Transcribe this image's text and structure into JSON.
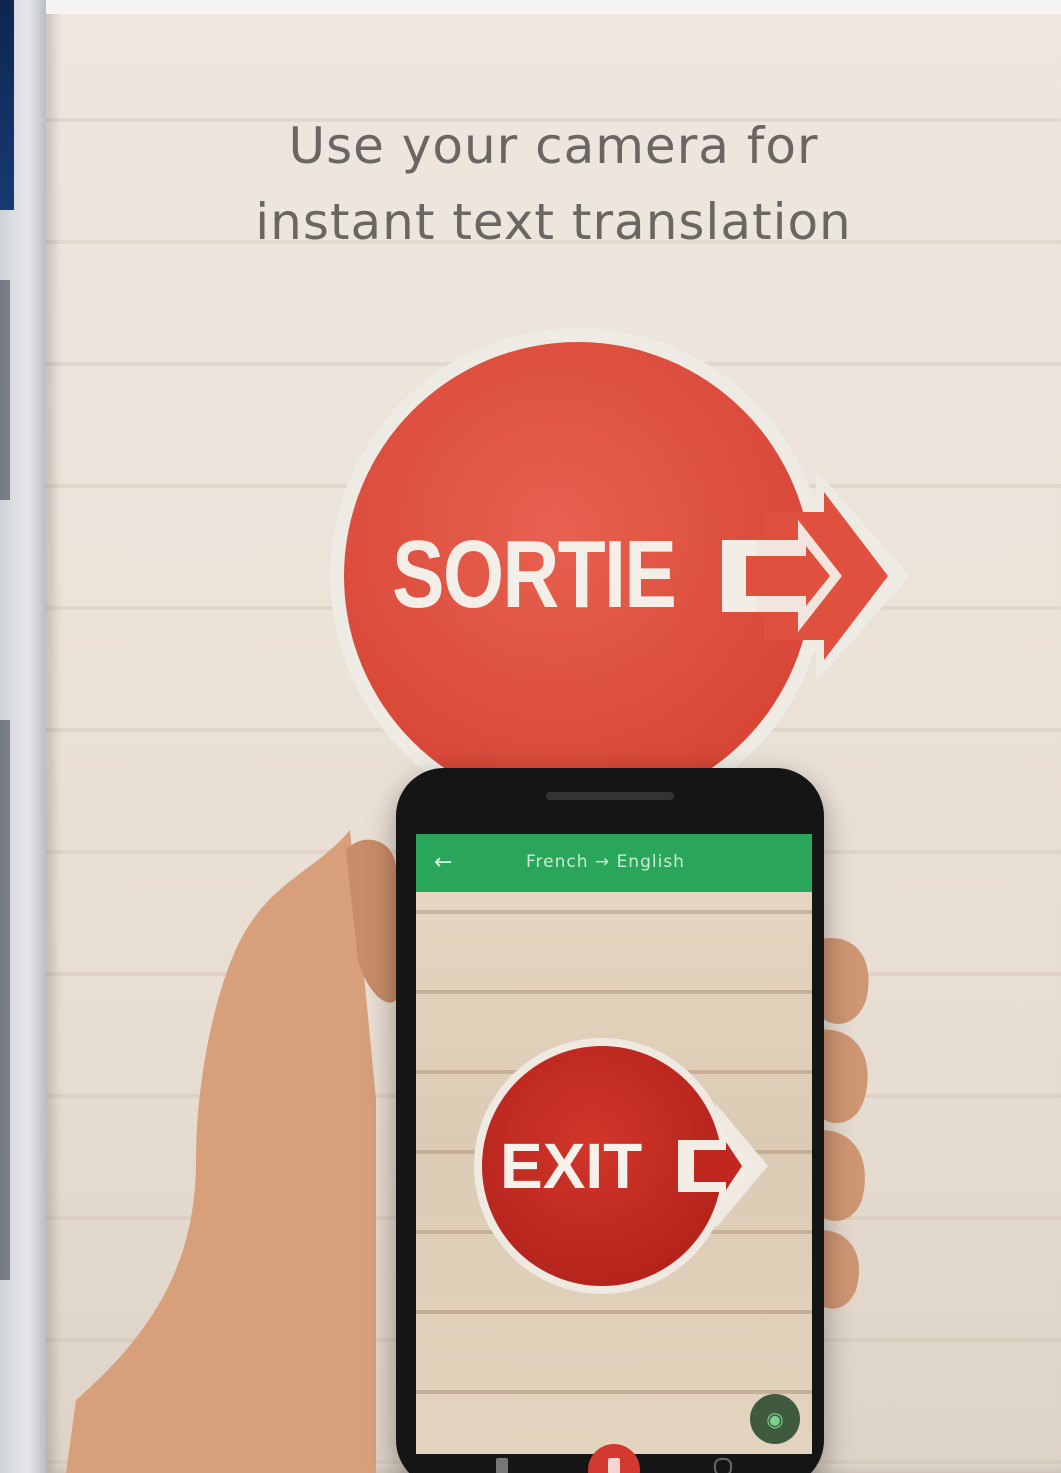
{
  "promo": {
    "headline_line1": "Use your camera for",
    "headline_line2": "instant text translation"
  },
  "wall_sign": {
    "text": "SORTIE",
    "color": "#e0503f"
  },
  "phone": {
    "app_bar": {
      "back_icon": "arrow-left-icon",
      "title": "French → English",
      "color": "#2aa65a"
    },
    "translated_sign": {
      "text": "EXIT",
      "color": "#c0281f"
    },
    "fab_icon": "camera-icon",
    "bottom_nav": {
      "left_icon": "image-icon",
      "center_icon": "camera-icon",
      "right_icon": "settings-icon"
    }
  }
}
